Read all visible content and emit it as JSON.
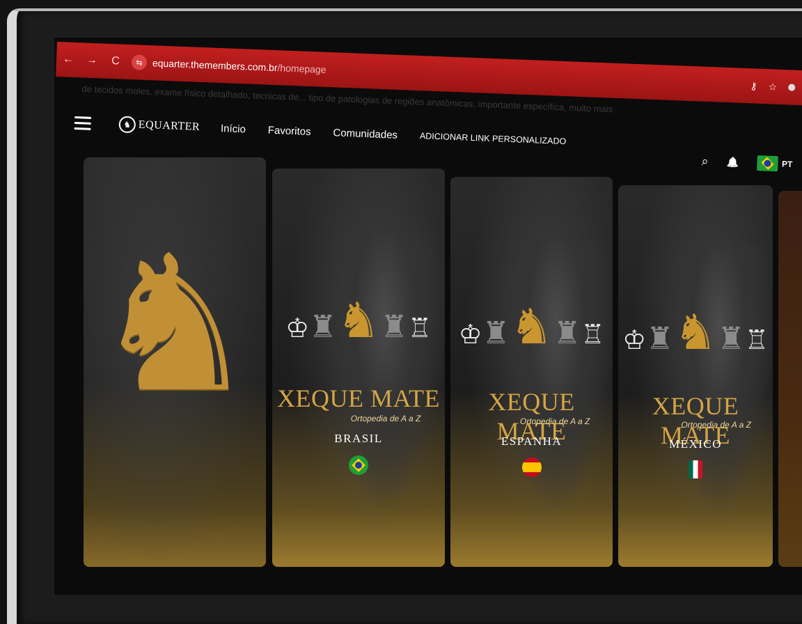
{
  "browser": {
    "back_icon": "←",
    "forward_icon": "→",
    "reload_icon": "C",
    "site_icon": "⇆",
    "url_domain": "equarter.themembers.com.br",
    "url_path": "/homepage",
    "key_icon": "⚷",
    "star_icon": "☆"
  },
  "ghost_text": "de tecidos moles, exame físico detalhado, tecnicas de... tipo de patologias de regiões anatômicas, importante específica, muito mais",
  "header": {
    "logo_mark": "♞",
    "logo_text": "EQUARTER",
    "nav": [
      "Início",
      "Favoritos",
      "Comunidades",
      "ADICIONAR LINK PERSONALIZADO"
    ],
    "search_icon": "⌕",
    "bell_icon": "🔔",
    "language": "PT"
  },
  "banner": {
    "knight_glyph": "♞"
  },
  "courses": [
    {
      "title": "XEQUE MATE",
      "subtitle": "Ortopedia de A a Z",
      "country": "BRASIL",
      "flag": "br"
    },
    {
      "title": "XEQUE MATE",
      "subtitle": "Ortopedia de A a Z",
      "country": "ESPANHA",
      "flag": "es"
    },
    {
      "title": "XEQUE MATE",
      "subtitle": "Ortopedia de A a Z",
      "country": "MÉXICO",
      "flag": "mx"
    }
  ],
  "chess_glyphs": {
    "white_king": "♔",
    "white_pawn": "♙",
    "grey_rook": "♜",
    "gold_knight": "♞",
    "white_rook": "♖"
  }
}
